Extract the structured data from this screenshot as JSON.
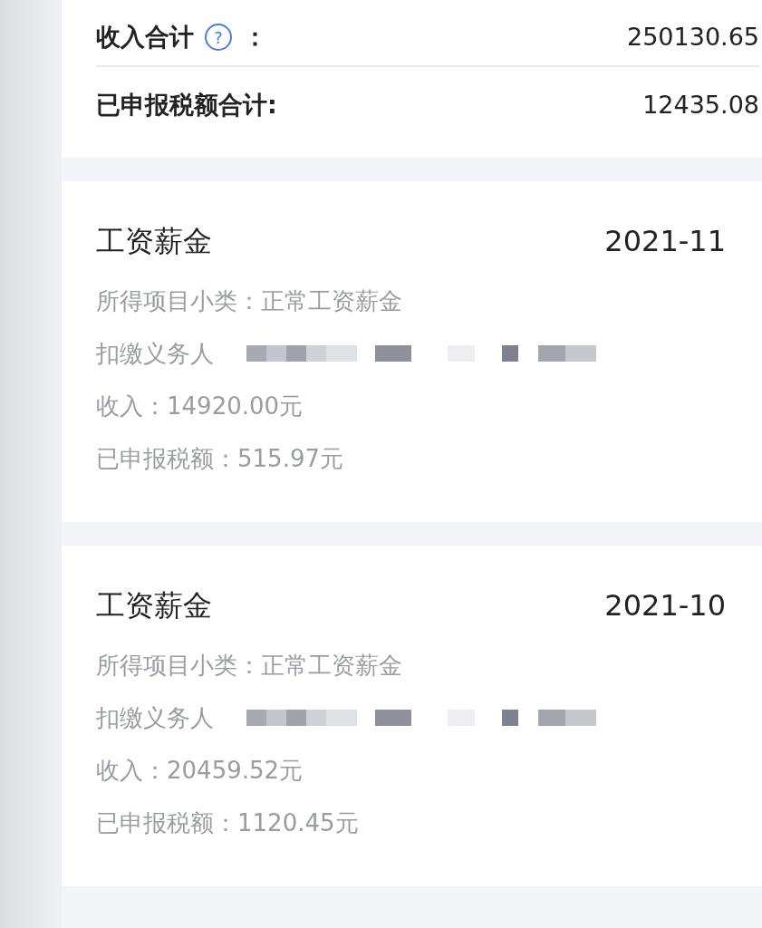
{
  "summary": [
    {
      "label": "收入合计",
      "help": "?",
      "colon": "：",
      "value": "250130.65"
    },
    {
      "label": "已申报税额合计:",
      "value": "12435.08"
    }
  ],
  "records": [
    {
      "title": "工资薪金",
      "date": "2021-11",
      "lines": [
        {
          "kind": "text",
          "text": "所得项目小类：正常工资薪金"
        },
        {
          "kind": "redacted",
          "text": "扣缴义务人"
        },
        {
          "kind": "text",
          "text": "收入：14920.00元"
        },
        {
          "kind": "text",
          "text": "已申报税额：515.97元"
        }
      ]
    },
    {
      "title": "工资薪金",
      "date": "2021-10",
      "lines": [
        {
          "kind": "text",
          "text": "所得项目小类：正常工资薪金"
        },
        {
          "kind": "redacted",
          "text": "扣缴义务人"
        },
        {
          "kind": "text",
          "text": "收入：20459.52元"
        },
        {
          "kind": "text",
          "text": "已申报税额：1120.45元"
        }
      ]
    }
  ]
}
